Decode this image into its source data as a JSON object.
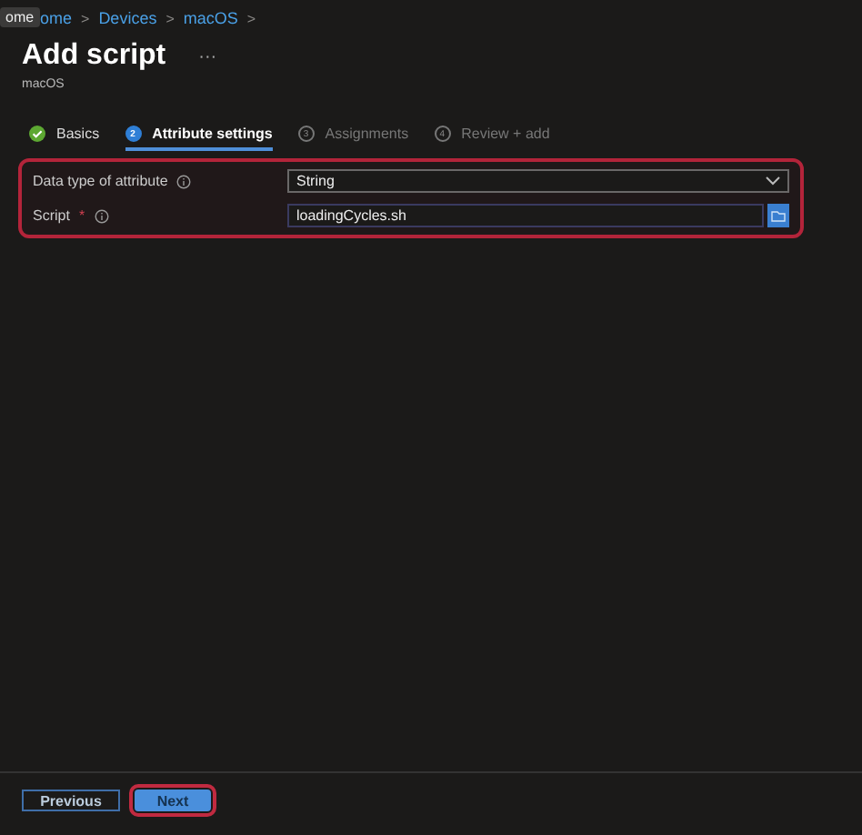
{
  "tooltip": {
    "text": "ome"
  },
  "breadcrumb": [
    "ome",
    "Devices",
    "macOS"
  ],
  "breadcrumb_separator": ">",
  "title": "Add script",
  "more_button": "···",
  "subtitle": "macOS",
  "steps": [
    {
      "kind": "done",
      "label": "Basics",
      "selected": false
    },
    {
      "kind": "number",
      "number": "2",
      "label": "Attribute settings",
      "selected": true
    },
    {
      "kind": "number",
      "number": "3",
      "label": "Assignments",
      "selected": false
    },
    {
      "kind": "number",
      "number": "4",
      "label": "Review + add",
      "selected": false
    }
  ],
  "form": {
    "highlighted": true,
    "fields": [
      {
        "kind": "dropdown",
        "label": "Data type of attribute",
        "value": "String"
      },
      {
        "kind": "file",
        "label": "Script",
        "required_mark": "*",
        "value": "loadingCycles.sh"
      }
    ]
  },
  "footer": {
    "buttons": [
      {
        "label": "Previous",
        "primary": false,
        "highlighted": false
      },
      {
        "label": "Next",
        "primary": true,
        "highlighted": true
      }
    ]
  }
}
